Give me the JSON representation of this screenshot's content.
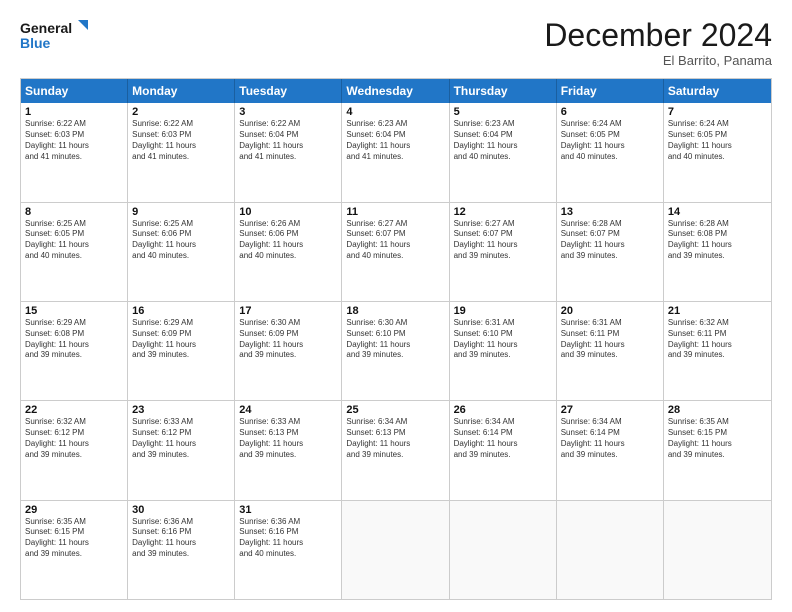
{
  "logo": {
    "line1": "General",
    "line2": "Blue"
  },
  "title": "December 2024",
  "subtitle": "El Barrito, Panama",
  "days_of_week": [
    "Sunday",
    "Monday",
    "Tuesday",
    "Wednesday",
    "Thursday",
    "Friday",
    "Saturday"
  ],
  "weeks": [
    [
      {
        "day": "1",
        "info": "Sunrise: 6:22 AM\nSunset: 6:03 PM\nDaylight: 11 hours\nand 41 minutes."
      },
      {
        "day": "2",
        "info": "Sunrise: 6:22 AM\nSunset: 6:03 PM\nDaylight: 11 hours\nand 41 minutes."
      },
      {
        "day": "3",
        "info": "Sunrise: 6:22 AM\nSunset: 6:04 PM\nDaylight: 11 hours\nand 41 minutes."
      },
      {
        "day": "4",
        "info": "Sunrise: 6:23 AM\nSunset: 6:04 PM\nDaylight: 11 hours\nand 41 minutes."
      },
      {
        "day": "5",
        "info": "Sunrise: 6:23 AM\nSunset: 6:04 PM\nDaylight: 11 hours\nand 40 minutes."
      },
      {
        "day": "6",
        "info": "Sunrise: 6:24 AM\nSunset: 6:05 PM\nDaylight: 11 hours\nand 40 minutes."
      },
      {
        "day": "7",
        "info": "Sunrise: 6:24 AM\nSunset: 6:05 PM\nDaylight: 11 hours\nand 40 minutes."
      }
    ],
    [
      {
        "day": "8",
        "info": "Sunrise: 6:25 AM\nSunset: 6:05 PM\nDaylight: 11 hours\nand 40 minutes."
      },
      {
        "day": "9",
        "info": "Sunrise: 6:25 AM\nSunset: 6:06 PM\nDaylight: 11 hours\nand 40 minutes."
      },
      {
        "day": "10",
        "info": "Sunrise: 6:26 AM\nSunset: 6:06 PM\nDaylight: 11 hours\nand 40 minutes."
      },
      {
        "day": "11",
        "info": "Sunrise: 6:27 AM\nSunset: 6:07 PM\nDaylight: 11 hours\nand 40 minutes."
      },
      {
        "day": "12",
        "info": "Sunrise: 6:27 AM\nSunset: 6:07 PM\nDaylight: 11 hours\nand 39 minutes."
      },
      {
        "day": "13",
        "info": "Sunrise: 6:28 AM\nSunset: 6:07 PM\nDaylight: 11 hours\nand 39 minutes."
      },
      {
        "day": "14",
        "info": "Sunrise: 6:28 AM\nSunset: 6:08 PM\nDaylight: 11 hours\nand 39 minutes."
      }
    ],
    [
      {
        "day": "15",
        "info": "Sunrise: 6:29 AM\nSunset: 6:08 PM\nDaylight: 11 hours\nand 39 minutes."
      },
      {
        "day": "16",
        "info": "Sunrise: 6:29 AM\nSunset: 6:09 PM\nDaylight: 11 hours\nand 39 minutes."
      },
      {
        "day": "17",
        "info": "Sunrise: 6:30 AM\nSunset: 6:09 PM\nDaylight: 11 hours\nand 39 minutes."
      },
      {
        "day": "18",
        "info": "Sunrise: 6:30 AM\nSunset: 6:10 PM\nDaylight: 11 hours\nand 39 minutes."
      },
      {
        "day": "19",
        "info": "Sunrise: 6:31 AM\nSunset: 6:10 PM\nDaylight: 11 hours\nand 39 minutes."
      },
      {
        "day": "20",
        "info": "Sunrise: 6:31 AM\nSunset: 6:11 PM\nDaylight: 11 hours\nand 39 minutes."
      },
      {
        "day": "21",
        "info": "Sunrise: 6:32 AM\nSunset: 6:11 PM\nDaylight: 11 hours\nand 39 minutes."
      }
    ],
    [
      {
        "day": "22",
        "info": "Sunrise: 6:32 AM\nSunset: 6:12 PM\nDaylight: 11 hours\nand 39 minutes."
      },
      {
        "day": "23",
        "info": "Sunrise: 6:33 AM\nSunset: 6:12 PM\nDaylight: 11 hours\nand 39 minutes."
      },
      {
        "day": "24",
        "info": "Sunrise: 6:33 AM\nSunset: 6:13 PM\nDaylight: 11 hours\nand 39 minutes."
      },
      {
        "day": "25",
        "info": "Sunrise: 6:34 AM\nSunset: 6:13 PM\nDaylight: 11 hours\nand 39 minutes."
      },
      {
        "day": "26",
        "info": "Sunrise: 6:34 AM\nSunset: 6:14 PM\nDaylight: 11 hours\nand 39 minutes."
      },
      {
        "day": "27",
        "info": "Sunrise: 6:34 AM\nSunset: 6:14 PM\nDaylight: 11 hours\nand 39 minutes."
      },
      {
        "day": "28",
        "info": "Sunrise: 6:35 AM\nSunset: 6:15 PM\nDaylight: 11 hours\nand 39 minutes."
      }
    ],
    [
      {
        "day": "29",
        "info": "Sunrise: 6:35 AM\nSunset: 6:15 PM\nDaylight: 11 hours\nand 39 minutes."
      },
      {
        "day": "30",
        "info": "Sunrise: 6:36 AM\nSunset: 6:16 PM\nDaylight: 11 hours\nand 39 minutes."
      },
      {
        "day": "31",
        "info": "Sunrise: 6:36 AM\nSunset: 6:16 PM\nDaylight: 11 hours\nand 40 minutes."
      },
      {
        "day": "",
        "info": ""
      },
      {
        "day": "",
        "info": ""
      },
      {
        "day": "",
        "info": ""
      },
      {
        "day": "",
        "info": ""
      }
    ]
  ]
}
